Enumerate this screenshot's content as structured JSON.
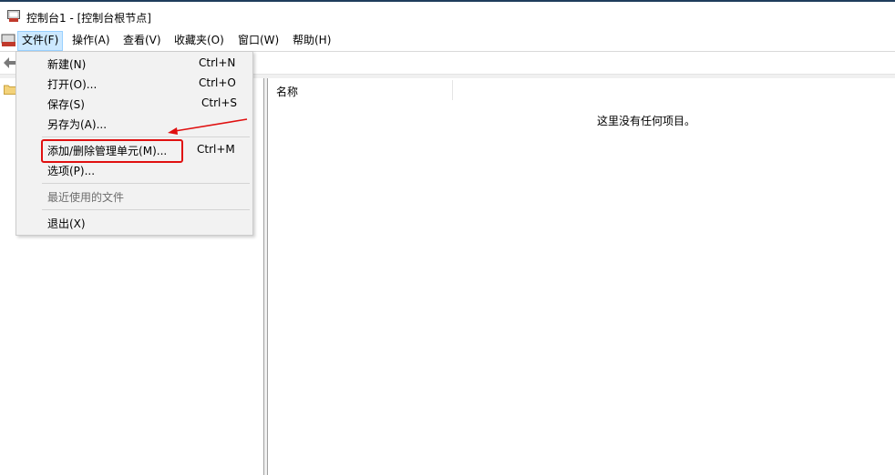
{
  "window": {
    "title": "控制台1 - [控制台根节点]"
  },
  "menubar": {
    "items": [
      "文件(F)",
      "操作(A)",
      "查看(V)",
      "收藏夹(O)",
      "窗口(W)",
      "帮助(H)"
    ]
  },
  "file_menu": {
    "new": {
      "label": "新建(N)",
      "shortcut": "Ctrl+N"
    },
    "open": {
      "label": "打开(O)...",
      "shortcut": "Ctrl+O"
    },
    "save": {
      "label": "保存(S)",
      "shortcut": "Ctrl+S"
    },
    "save_as": {
      "label": "另存为(A)..."
    },
    "add_remove_snapin": {
      "label": "添加/删除管理单元(M)...",
      "shortcut": "Ctrl+M"
    },
    "options": {
      "label": "选项(P)..."
    },
    "recent_files": {
      "label": "最近使用的文件"
    },
    "exit": {
      "label": "退出(X)"
    }
  },
  "details_pane": {
    "column_name": "名称",
    "empty_message": "这里没有任何项目。"
  },
  "colors": {
    "annotation_red": "#e01010",
    "menu_active": "#cce8ff"
  }
}
